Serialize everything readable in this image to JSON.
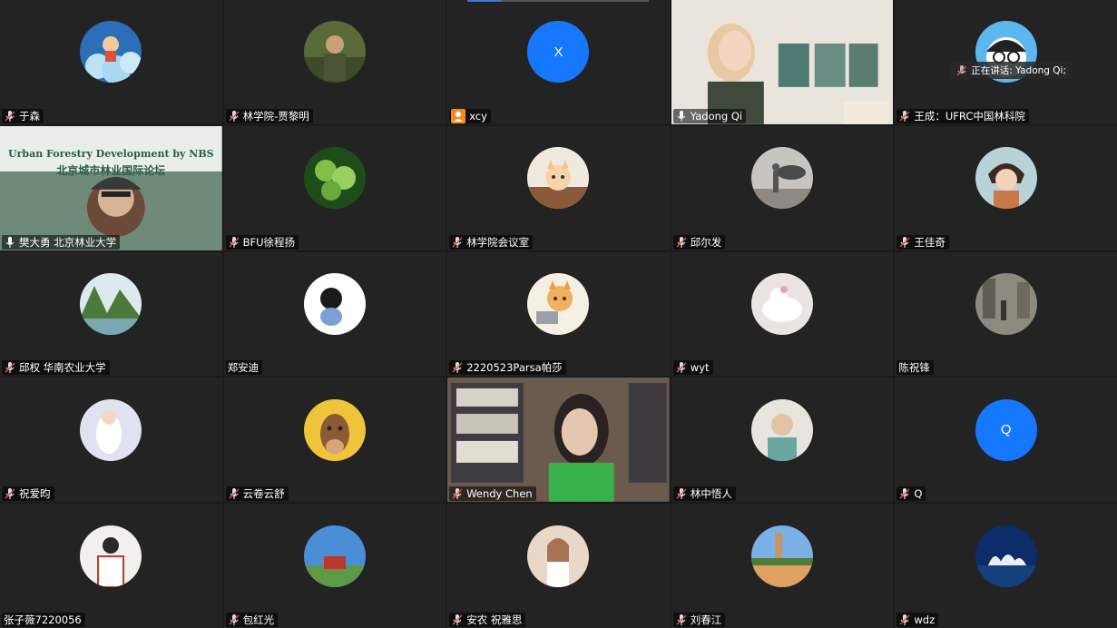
{
  "speaking_indicator": "正在讲话: Yadong Qi;",
  "banner": {
    "title_en": "Urban Forestry Development by NBS",
    "title_cn": "北京城市林业国际论坛"
  },
  "tiles": [
    {
      "name": "于森",
      "avatar": "cartoon-boy-clouds-avatar",
      "mic": "muted"
    },
    {
      "name": "林学院-贾黎明",
      "avatar": "man-outdoor-photo-avatar",
      "mic": "muted"
    },
    {
      "name": "xcy",
      "avatar_letter": "X",
      "mic": "none",
      "share": true
    },
    {
      "name": "Yadong Qi",
      "video": "woman-home-video",
      "mic": "on",
      "active": true
    },
    {
      "name": "王成：UFRC中国林科院",
      "avatar": "cartoon-glasses-avatar",
      "mic": "muted"
    },
    {
      "name": "樊大勇 北京林业大学",
      "video": "man-forum-banner-video",
      "mic": "on"
    },
    {
      "name": "BFU徐程扬",
      "avatar": "green-leaves-avatar",
      "mic": "muted"
    },
    {
      "name": "林学院会议室",
      "avatar": "kitten-avatar",
      "mic": "muted"
    },
    {
      "name": "邱尔发",
      "avatar": "person-statue-avatar",
      "mic": "muted"
    },
    {
      "name": "王佳奇",
      "avatar": "anime-boy-avatar",
      "mic": "muted"
    },
    {
      "name": "邱权 华南农业大学",
      "avatar": "mountain-lake-avatar",
      "mic": "muted"
    },
    {
      "name": "郑安迪",
      "avatar": "cartoon-girl-sketch-avatar",
      "mic": "none"
    },
    {
      "name": "2220523Parsa帕莎",
      "avatar": "cat-laptop-avatar",
      "mic": "muted"
    },
    {
      "name": "wyt",
      "avatar": "white-cat-avatar",
      "mic": "muted"
    },
    {
      "name": "陈祝锋",
      "avatar": "street-photo-avatar",
      "mic": "none"
    },
    {
      "name": "祝爱昀",
      "avatar": "couple-illustration-avatar",
      "mic": "muted"
    },
    {
      "name": "云卷云舒",
      "avatar": "cartoon-horse-avatar",
      "mic": "muted"
    },
    {
      "name": "Wendy Chen",
      "video": "woman-bookshelf-video",
      "mic": "muted"
    },
    {
      "name": "林中悟人",
      "avatar": "man-portrait-avatar",
      "mic": "muted"
    },
    {
      "name": "Q",
      "avatar_letter": "Q",
      "mic": "muted"
    },
    {
      "name": "张子薇7220056",
      "avatar": "person-tshirt-avatar",
      "mic": "none"
    },
    {
      "name": "包红光",
      "avatar": "house-landscape-avatar",
      "mic": "muted"
    },
    {
      "name": "安农 祝雅思",
      "avatar": "woman-photo-avatar",
      "mic": "muted"
    },
    {
      "name": "刘春江",
      "avatar": "campus-lake-avatar",
      "mic": "muted"
    },
    {
      "name": "wdz",
      "avatar": "opera-house-night-avatar",
      "mic": "muted"
    }
  ],
  "colors": {
    "tile_bg": "#232323",
    "letter_avatar": "#1677ff",
    "active_border": "#5ec85e",
    "muted_mic": "#e04a4a",
    "share": "#f28a1e"
  }
}
